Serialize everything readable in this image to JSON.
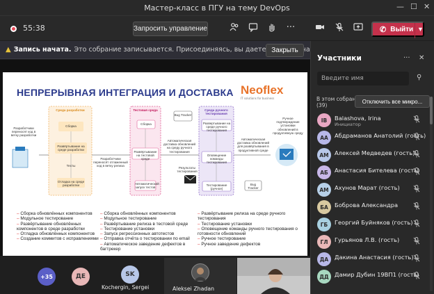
{
  "window": {
    "title": "Мастер-класс в ПГУ на тему DevOps"
  },
  "toolbar": {
    "timer": "55:38",
    "request_control_label": "Запросить управление",
    "leave_label": "Выйти"
  },
  "banner": {
    "title": "Запись начата.",
    "message": "Это собрание записывается. Присоединяясь, вы даете согласие на его запись....",
    "close_label": "Закрыть"
  },
  "slide": {
    "title": "НЕПРЕРЫВНАЯ ИНТЕГРАЦИЯ И ДОСТАВКА",
    "logo": "Neoflex",
    "logo_sub": "IT solutions for business",
    "diagram": {
      "dev_actor": "Разработчики переносят код в ветку разработки",
      "dev_env": "Среда разработки",
      "build1": "Сборка",
      "deploy_dev": "Развёртывание на среде разработки",
      "autotests_dev": "Тесты",
      "unit_tests": "Отладка на среде разработки",
      "transfer": "Разработчики переносят отлаженный код в ветку релиза",
      "test_env": "Тестовая среда",
      "build2": "Сборка",
      "deploy_test": "Развёртывание на тестовой среде",
      "autotests_run": "Автоматический запуск тестов",
      "bug_tracker1": "Bug Tracker",
      "auto_delivery": "Автоматическая доставка обновлений на среду ручного тестирования",
      "results": "Результаты тестирования",
      "manual_env": "Среда ручного тестирования",
      "deploy_manual": "Развертывание на среде ручного тестирования",
      "notify": "Оповещение команды тестирования",
      "manual_test": "Тестирование (ручное)",
      "bug_tracker2": "Bug Tracker",
      "auto_prod": "Автоматическая доставка обновлений для развёртывания в продуктивной среде",
      "prod_actor": "Ручное подтверждение установки обновлений в продуктивную среду"
    },
    "bullets": {
      "col1": [
        "Сборка обновлённых компонентов",
        "Модульное тестирование",
        "Развёртывание обновлённых компонентов в среде разработки",
        "Отладка обновлённых компонентов",
        "Создание коммитов с исправлениями"
      ],
      "col2": [
        "Сборка обновлённых компонентов",
        "Модульное тестирование",
        "Развёртывание релиза в тестовой среде",
        "Тестирование установки",
        "Запуск регрессионных автотестов",
        "Отправка отчёта о тестировании по email",
        "Автоматическое заведение дефектов в багтрекер"
      ],
      "col3": [
        "Развёртывание релиза на среде ручного тестирования",
        "Тестирование установки",
        "Оповещение команды ручного тестирования о готовности обновлений",
        "Ручное тестирование",
        "Ручное заведение дефектов"
      ]
    }
  },
  "presenter": {
    "name": "Aleksei Zhadan"
  },
  "strip": {
    "overflow_count": "+35",
    "avatar_de": "ДЕ",
    "avatar_sk": "SK",
    "sk_name": "Kochergin, Sergei",
    "tile2_name": "Aleksei Zhadan"
  },
  "panel": {
    "title": "Участники",
    "search_placeholder": "Введите имя",
    "section_label": "В этом собрании",
    "section_count": "(39)",
    "mute_all_label": "Отключить все микро...",
    "participants": [
      {
        "initials": "IB",
        "name": "Balashova, Irina",
        "role": "Инициатор",
        "color": "#e9a7c3"
      },
      {
        "initials": "АА",
        "name": "Абдраманов Анатолий (гость)",
        "role": "",
        "color": "#b7b7e8"
      },
      {
        "initials": "АМ",
        "name": "Алексей Медведев (гость)",
        "role": "",
        "color": "#b7c7e8"
      },
      {
        "initials": "АБ",
        "name": "Анастасия Бителева (гость)",
        "role": "",
        "color": "#c8b7e8"
      },
      {
        "initials": "АМ",
        "name": "Ахунов Марат (гость)",
        "role": "",
        "color": "#b7d0e8"
      },
      {
        "initials": "БА",
        "name": "Боброва Александра",
        "role": "",
        "color": "#d8c9a0"
      },
      {
        "initials": "ГБ",
        "name": "Георгий Буйняков (гость)",
        "role": "",
        "color": "#a8d0e0"
      },
      {
        "initials": "ГЛ",
        "name": "Гурьянов Л.В. (гость)",
        "role": "",
        "color": "#e8b7b7"
      },
      {
        "initials": "ДА",
        "name": "Дакина Анастасия (гость)",
        "role": "",
        "color": "#b7b7e8"
      },
      {
        "initials": "ДД",
        "name": "Дамир Дубин 19ВП1 (гость)",
        "role": "",
        "color": "#a8d8c0"
      }
    ]
  },
  "colors": {
    "leave": "#c4314b",
    "accent_title": "#2b3a8c",
    "warn": "#e8c33a"
  },
  "icons": [
    "record-icon",
    "people-icon",
    "chat-icon",
    "raise-hand-icon",
    "more-icon",
    "camera-icon",
    "mic-off-icon",
    "share-icon",
    "phone-icon",
    "warning-icon",
    "invite-icon"
  ]
}
